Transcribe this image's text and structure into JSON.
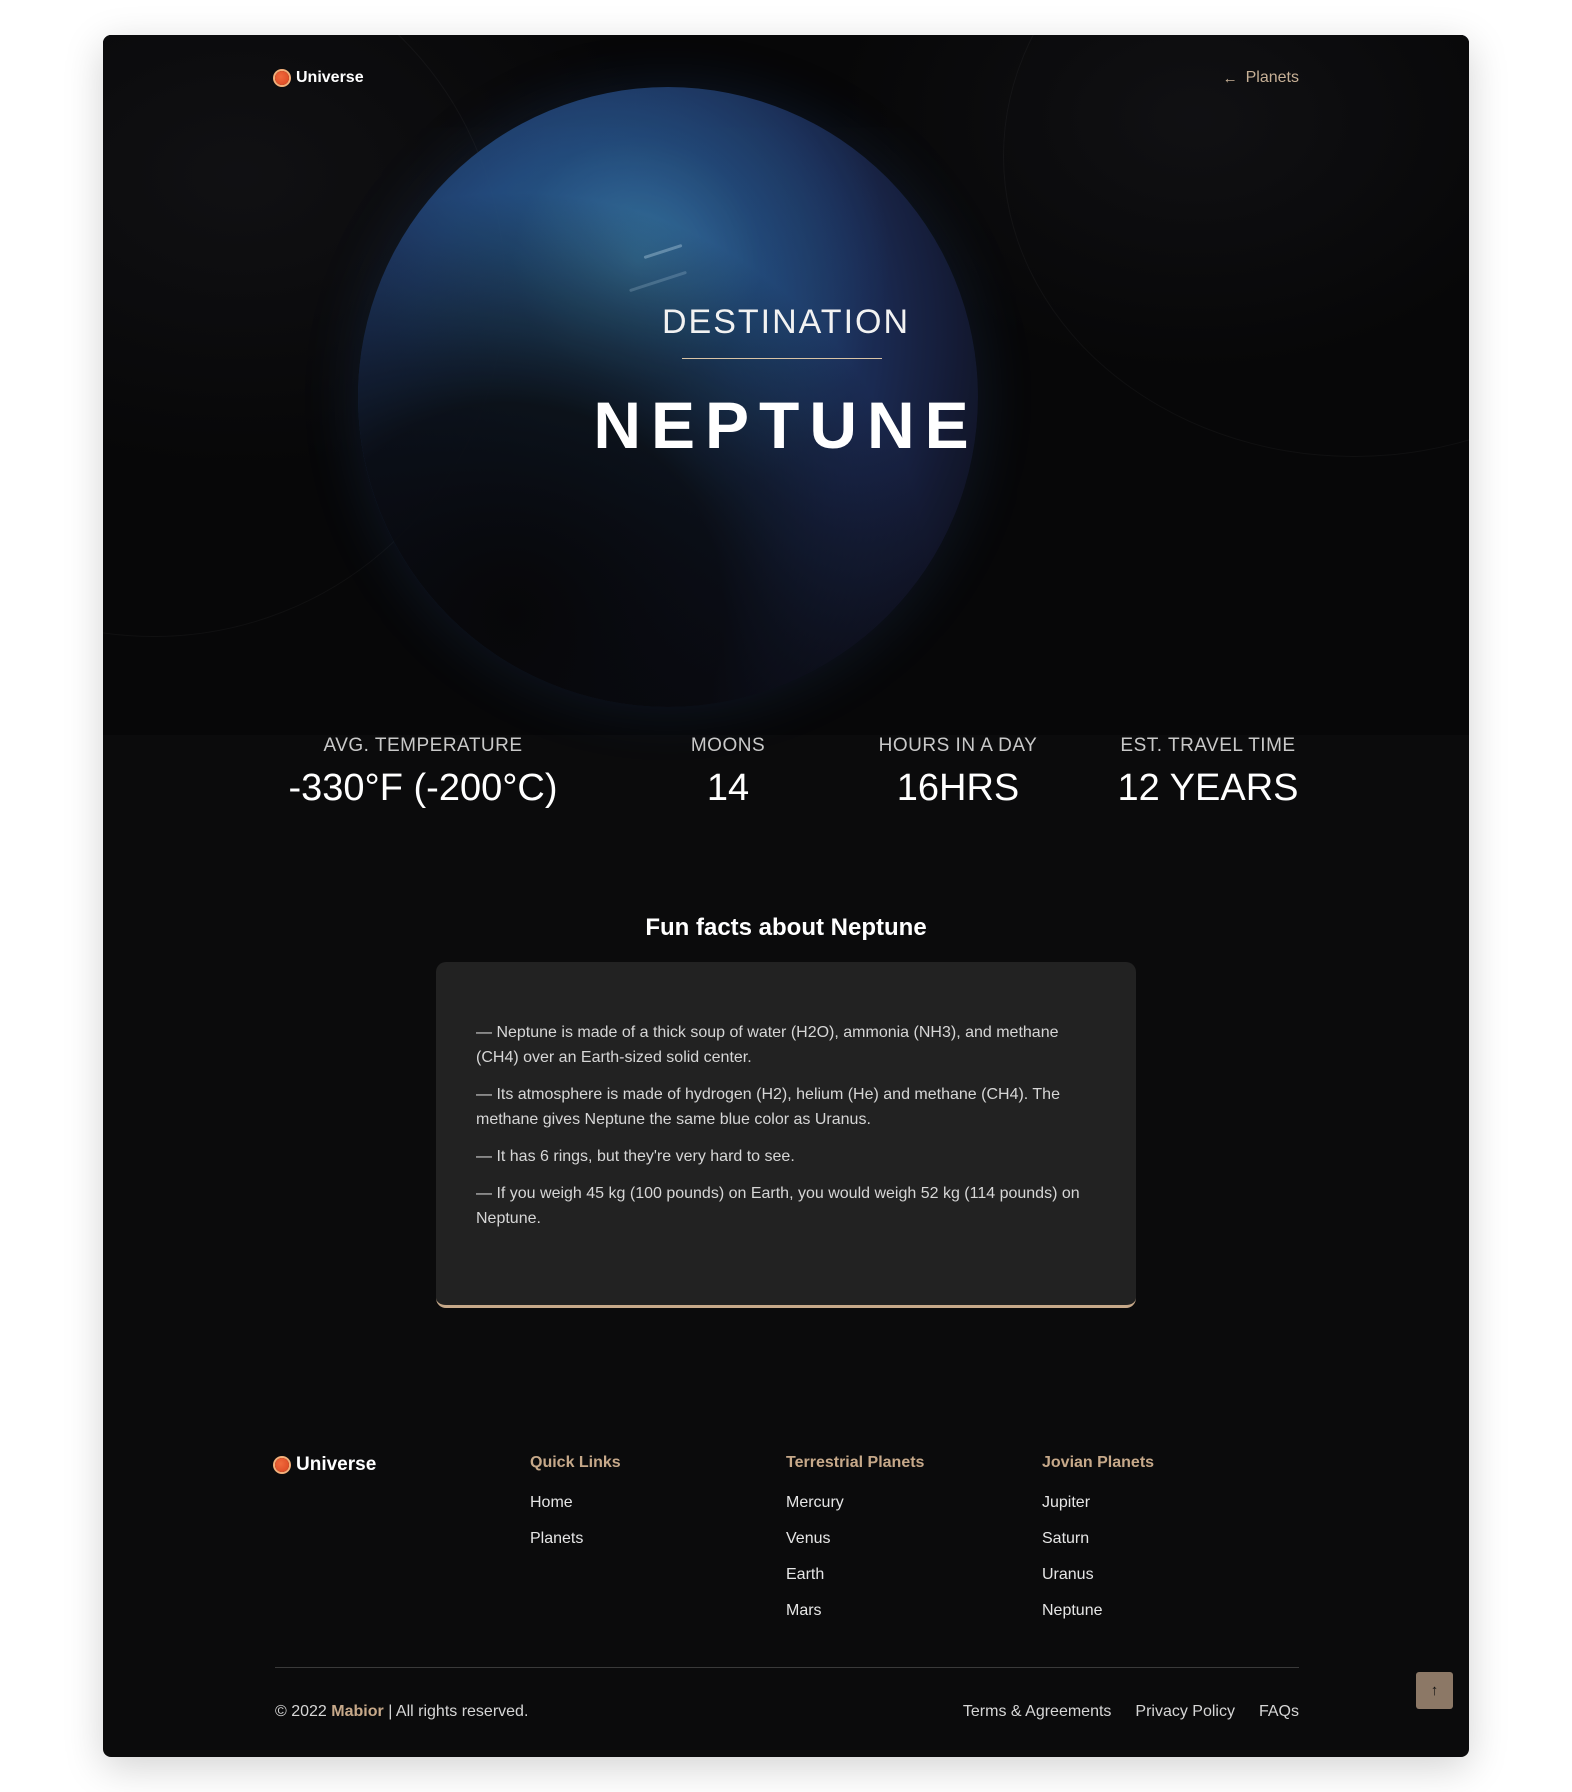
{
  "header": {
    "logo_text": "Universe",
    "back_link": "Planets"
  },
  "hero": {
    "eyebrow": "DESTINATION",
    "planet_name": "NEPTUNE"
  },
  "stats": [
    {
      "label": "AVG. TEMPERATURE",
      "value": "-330°F (-200°C)"
    },
    {
      "label": "MOONS",
      "value": "14"
    },
    {
      "label": "HOURS IN A DAY",
      "value": "16HRS"
    },
    {
      "label": "EST. TRAVEL TIME",
      "value": "12 YEARS"
    }
  ],
  "facts": {
    "title": "Fun facts about Neptune",
    "items": [
      "— Neptune is made of a thick soup of water (H2O), ammonia (NH3), and methane (CH4) over an Earth-sized solid center.",
      "— Its atmosphere is made of hydrogen (H2), helium (He) and methane (CH4). The methane gives Neptune the same blue color as Uranus.",
      "— It has 6 rings, but they're very hard to see.",
      "— If you weigh 45 kg (100 pounds) on Earth, you would weigh 52 kg (114 pounds) on Neptune."
    ]
  },
  "footer": {
    "logo_text": "Universe",
    "columns": [
      {
        "title": "Quick Links",
        "links": [
          "Home",
          "Planets"
        ]
      },
      {
        "title": "Terrestrial Planets",
        "links": [
          "Mercury",
          "Venus",
          "Earth",
          "Mars"
        ]
      },
      {
        "title": "Jovian Planets",
        "links": [
          "Jupiter",
          "Saturn",
          "Uranus",
          "Neptune"
        ]
      }
    ],
    "copyright_prefix": "© 2022",
    "copyright_brand": "Mabior",
    "copyright_suffix": "| All rights reserved.",
    "legal_links": [
      "Terms & Agreements",
      "Privacy Policy",
      "FAQs"
    ]
  },
  "icons": {
    "logo": "sun-icon",
    "back": "arrow-left-icon",
    "to_top": "arrow-up-icon"
  },
  "colors": {
    "accent": "#c7a98a",
    "background": "#0b0b0c",
    "card": "#222222"
  }
}
